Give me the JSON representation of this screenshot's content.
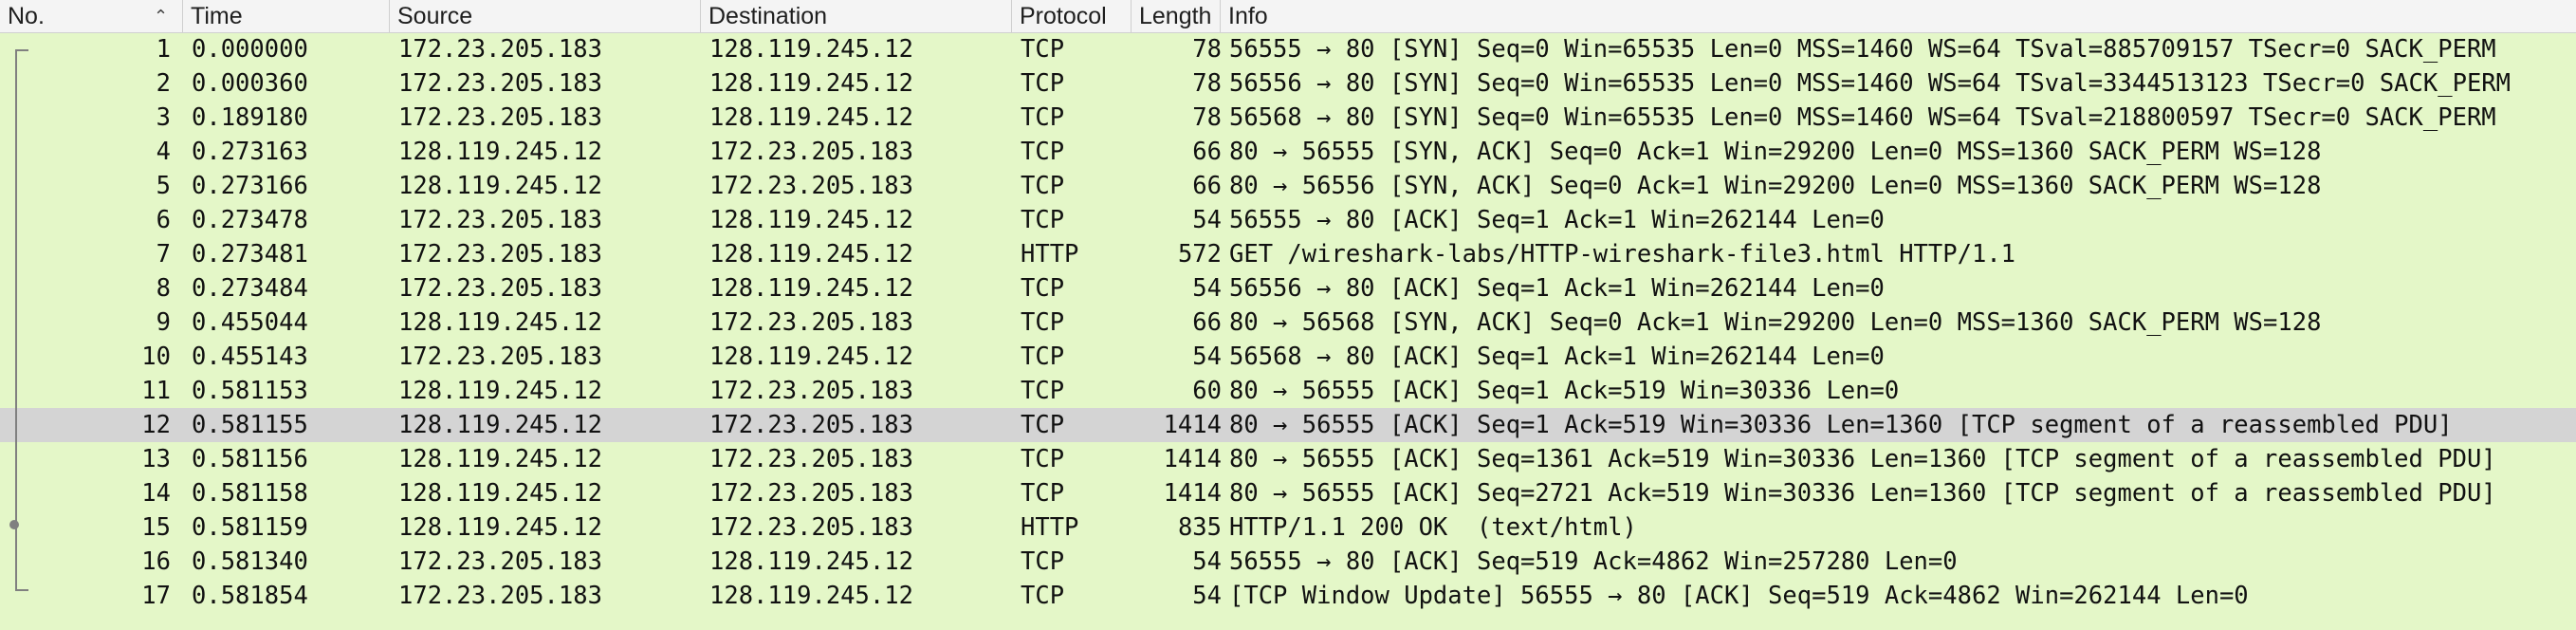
{
  "columns": {
    "no": "No.",
    "time": "Time",
    "source": "Source",
    "destination": "Destination",
    "protocol": "Protocol",
    "length": "Length",
    "info": "Info"
  },
  "sort_icon": "sort-ascending-icon",
  "colors": {
    "row_bg": "#e4f7c8",
    "selected_bg": "#d4d4d4",
    "header_bg": "#f4f4f4"
  },
  "selected_row": 12,
  "packets": [
    {
      "no": "1",
      "time": "0.000000",
      "source": "172.23.205.183",
      "destination": "128.119.245.12",
      "protocol": "TCP",
      "length": "78",
      "info": "56555 → 80 [SYN] Seq=0 Win=65535 Len=0 MSS=1460 WS=64 TSval=885709157 TSecr=0 SACK_PERM"
    },
    {
      "no": "2",
      "time": "0.000360",
      "source": "172.23.205.183",
      "destination": "128.119.245.12",
      "protocol": "TCP",
      "length": "78",
      "info": "56556 → 80 [SYN] Seq=0 Win=65535 Len=0 MSS=1460 WS=64 TSval=3344513123 TSecr=0 SACK_PERM"
    },
    {
      "no": "3",
      "time": "0.189180",
      "source": "172.23.205.183",
      "destination": "128.119.245.12",
      "protocol": "TCP",
      "length": "78",
      "info": "56568 → 80 [SYN] Seq=0 Win=65535 Len=0 MSS=1460 WS=64 TSval=218800597 TSecr=0 SACK_PERM"
    },
    {
      "no": "4",
      "time": "0.273163",
      "source": "128.119.245.12",
      "destination": "172.23.205.183",
      "protocol": "TCP",
      "length": "66",
      "info": "80 → 56555 [SYN, ACK] Seq=0 Ack=1 Win=29200 Len=0 MSS=1360 SACK_PERM WS=128"
    },
    {
      "no": "5",
      "time": "0.273166",
      "source": "128.119.245.12",
      "destination": "172.23.205.183",
      "protocol": "TCP",
      "length": "66",
      "info": "80 → 56556 [SYN, ACK] Seq=0 Ack=1 Win=29200 Len=0 MSS=1360 SACK_PERM WS=128"
    },
    {
      "no": "6",
      "time": "0.273478",
      "source": "172.23.205.183",
      "destination": "128.119.245.12",
      "protocol": "TCP",
      "length": "54",
      "info": "56555 → 80 [ACK] Seq=1 Ack=1 Win=262144 Len=0"
    },
    {
      "no": "7",
      "time": "0.273481",
      "source": "172.23.205.183",
      "destination": "128.119.245.12",
      "protocol": "HTTP",
      "length": "572",
      "info": "GET /wireshark-labs/HTTP-wireshark-file3.html HTTP/1.1"
    },
    {
      "no": "8",
      "time": "0.273484",
      "source": "172.23.205.183",
      "destination": "128.119.245.12",
      "protocol": "TCP",
      "length": "54",
      "info": "56556 → 80 [ACK] Seq=1 Ack=1 Win=262144 Len=0"
    },
    {
      "no": "9",
      "time": "0.455044",
      "source": "128.119.245.12",
      "destination": "172.23.205.183",
      "protocol": "TCP",
      "length": "66",
      "info": "80 → 56568 [SYN, ACK] Seq=0 Ack=1 Win=29200 Len=0 MSS=1360 SACK_PERM WS=128"
    },
    {
      "no": "10",
      "time": "0.455143",
      "source": "172.23.205.183",
      "destination": "128.119.245.12",
      "protocol": "TCP",
      "length": "54",
      "info": "56568 → 80 [ACK] Seq=1 Ack=1 Win=262144 Len=0"
    },
    {
      "no": "11",
      "time": "0.581153",
      "source": "128.119.245.12",
      "destination": "172.23.205.183",
      "protocol": "TCP",
      "length": "60",
      "info": "80 → 56555 [ACK] Seq=1 Ack=519 Win=30336 Len=0"
    },
    {
      "no": "12",
      "time": "0.581155",
      "source": "128.119.245.12",
      "destination": "172.23.205.183",
      "protocol": "TCP",
      "length": "1414",
      "info": "80 → 56555 [ACK] Seq=1 Ack=519 Win=30336 Len=1360 [TCP segment of a reassembled PDU]"
    },
    {
      "no": "13",
      "time": "0.581156",
      "source": "128.119.245.12",
      "destination": "172.23.205.183",
      "protocol": "TCP",
      "length": "1414",
      "info": "80 → 56555 [ACK] Seq=1361 Ack=519 Win=30336 Len=1360 [TCP segment of a reassembled PDU]"
    },
    {
      "no": "14",
      "time": "0.581158",
      "source": "128.119.245.12",
      "destination": "172.23.205.183",
      "protocol": "TCP",
      "length": "1414",
      "info": "80 → 56555 [ACK] Seq=2721 Ack=519 Win=30336 Len=1360 [TCP segment of a reassembled PDU]"
    },
    {
      "no": "15",
      "time": "0.581159",
      "source": "128.119.245.12",
      "destination": "172.23.205.183",
      "protocol": "HTTP",
      "length": "835",
      "info": "HTTP/1.1 200 OK  (text/html)"
    },
    {
      "no": "16",
      "time": "0.581340",
      "source": "172.23.205.183",
      "destination": "128.119.245.12",
      "protocol": "TCP",
      "length": "54",
      "info": "56555 → 80 [ACK] Seq=519 Ack=4862 Win=257280 Len=0"
    },
    {
      "no": "17",
      "time": "0.581854",
      "source": "172.23.205.183",
      "destination": "128.119.245.12",
      "protocol": "TCP",
      "length": "54",
      "info": "[TCP Window Update] 56555 → 80 [ACK] Seq=519 Ack=4862 Win=262144 Len=0"
    }
  ]
}
